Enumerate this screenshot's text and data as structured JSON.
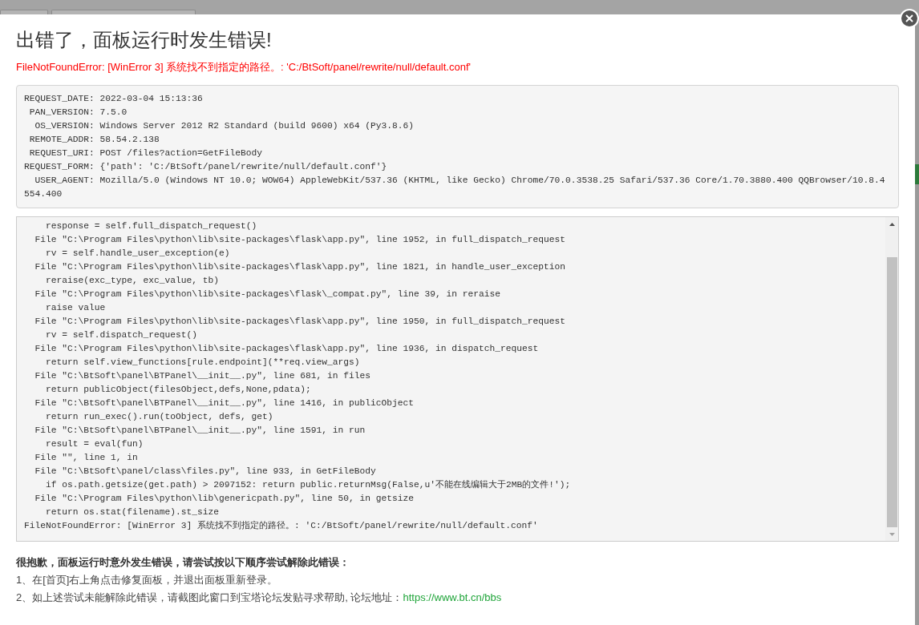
{
  "dialog": {
    "title": "出错了，面板运行时发生错误!",
    "error_message": "FileNotFoundError: [WinError 3] 系统找不到指定的路径。: 'C:/BtSoft/panel/rewrite/null/default.conf'"
  },
  "request_info": [
    "REQUEST_DATE: 2022-03-04 15:13:36",
    " PAN_VERSION: 7.5.0",
    "  OS_VERSION: Windows Server 2012 R2 Standard (build 9600) x64 (Py3.8.6)",
    " REMOTE_ADDR: 58.54.2.138",
    " REQUEST_URI: POST /files?action=GetFileBody",
    "REQUEST_FORM: {'path': 'C:/BtSoft/panel/rewrite/null/default.conf'}",
    "  USER_AGENT: Mozilla/5.0 (Windows NT 10.0; WOW64) AppleWebKit/537.36 (KHTML, like Gecko) Chrome/70.0.3538.25 Safari/537.36 Core/1.70.3880.400 QQBrowser/10.8.4554.400"
  ],
  "traceback": [
    "    response = self.full_dispatch_request()",
    "  File \"C:\\Program Files\\python\\lib\\site-packages\\flask\\app.py\", line 1952, in full_dispatch_request",
    "    rv = self.handle_user_exception(e)",
    "  File \"C:\\Program Files\\python\\lib\\site-packages\\flask\\app.py\", line 1821, in handle_user_exception",
    "    reraise(exc_type, exc_value, tb)",
    "  File \"C:\\Program Files\\python\\lib\\site-packages\\flask\\_compat.py\", line 39, in reraise",
    "    raise value",
    "  File \"C:\\Program Files\\python\\lib\\site-packages\\flask\\app.py\", line 1950, in full_dispatch_request",
    "    rv = self.dispatch_request()",
    "  File \"C:\\Program Files\\python\\lib\\site-packages\\flask\\app.py\", line 1936, in dispatch_request",
    "    return self.view_functions[rule.endpoint](**req.view_args)",
    "  File \"C:\\BtSoft\\panel\\BTPanel\\__init__.py\", line 681, in files",
    "    return publicObject(filesObject,defs,None,pdata);",
    "  File \"C:\\BtSoft\\panel\\BTPanel\\__init__.py\", line 1416, in publicObject",
    "    return run_exec().run(toObject, defs, get)",
    "  File \"C:\\BtSoft\\panel\\BTPanel\\__init__.py\", line 1591, in run",
    "    result = eval(fun)",
    "  File \"\", line 1, in",
    "  File \"C:\\BtSoft\\panel/class\\files.py\", line 933, in GetFileBody",
    "    if os.path.getsize(get.path) > 2097152: return public.returnMsg(False,u'不能在线编辑大于2MB的文件!');",
    "  File \"C:\\Program Files\\python\\lib\\genericpath.py\", line 50, in getsize",
    "    return os.stat(filename).st_size",
    "FileNotFoundError: [WinError 3] 系统找不到指定的路径。: 'C:/BtSoft/panel/rewrite/null/default.conf'"
  ],
  "help": {
    "heading": "很抱歉，面板运行时意外发生错误，请尝试按以下顺序尝试解除此错误：",
    "steps": [
      {
        "text": "1、在[首页]右上角点击修复面板，并退出面板重新登录。"
      },
      {
        "text": "2、如上述尝试未能解除此错误，请截图此窗口到宝塔论坛发贴寻求帮助, 论坛地址：",
        "link": "https://www.bt.cn/bbs"
      }
    ]
  }
}
